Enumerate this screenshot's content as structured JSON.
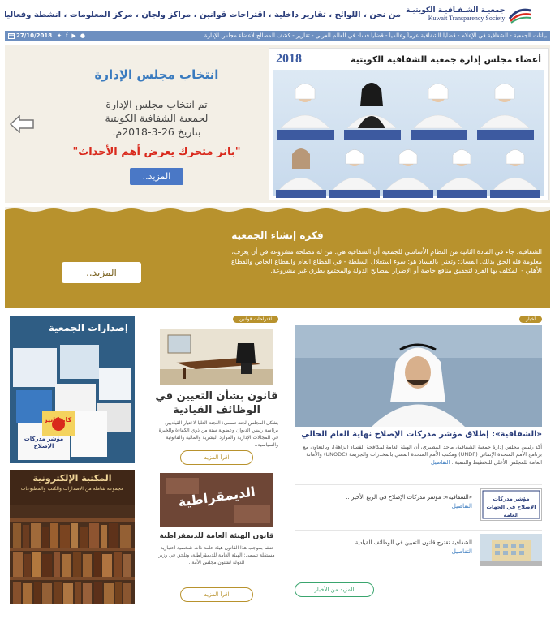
{
  "header": {
    "logo_ar": "جمعيـة الشـفـافيـة الكويتيـة",
    "logo_en": "Kuwait Transparency Society",
    "nav_text": "من نحن ، اللوائح ، تقارير داخلية ، اقتراحات قوانين ، مراكز ولجان ، مركز المعلومات ، أنشطة وفعاليات ، تواصل"
  },
  "subbar": {
    "date": "27/10/2018",
    "news": "بيانات الجمعية - الشفافية في الإعلام - قضايا الشفافية عربياً وعالمياً - قضايا فساد في العالم العربي - تقارير - كشف المصالح لأعضاء مجلس الإدارة"
  },
  "slider": {
    "title": "انتخاب مجلس الإدارة",
    "body_lines": [
      "تم انتخاب مجلس الإدارة",
      "لجمعية الشفافية الكويتية",
      "بتاريخ 26-3-2018م."
    ],
    "banner": "\"بانر متحرك يعرض أهم الأحداث\"",
    "button": "المزيد..",
    "board_title": "أعضاء مجلس إدارة جمعية الشفافية الكويتية",
    "board_year": "2018"
  },
  "idea": {
    "title": "فكرة إنشاء الجمعية",
    "text": "الشفافية: جاء في المادة الثانية من النظام الأساسي للجمعية أن الشفافية هي: من له مصلحة مشروعة في أن يعرف، معلومة فله الحق بذلك. الفساد: وتعني بالفساد هو: سوء استغلال السلطة - في القطاع العام والقطاع الخاص والقطاع الأهلي - المكلف بها الفرد لتحقيق منافع خاصة أو الإضرار بمصالح الدولة والمجتمع بطرق غير مشروعة.",
    "button": "المزيد.."
  },
  "news": {
    "tag": "أخبار",
    "headline": "«الشفافية»: إطلاق مؤشر مدركات الإصلاح نهاية العام الحالي",
    "excerpt": "أكد رئيس مجلس إدارة جمعية الشفافية، ماجد المطيري، أن الهيئة العامة لمكافحة الفساد (نزاهة)، وبالتعاون مع برنامج الأمم المتحدة الإنمائي (UNDP) ومكتب الأمم المتحدة المعني بالمخدرات والجريمة (UNODC) والأمانة العامة للمجلس الأعلى للتخطيط والتنمية..",
    "excerpt_more": "التفاصيل",
    "item1_thumb": "مؤشر مدركات الإصلاح في الجهات العامة",
    "item1_text": "«الشفافية»: مؤشر مدركات الإصلاح في الربع الأخير ..",
    "item1_more": "التفاصيل",
    "item2_text": "الشفافية تقترح قانون التعيين في الوظائف القيادية..",
    "item2_more": "التفاصيل",
    "more_button": "المزيد من الأخبار"
  },
  "proposals": {
    "tag": "اقتراحات قوانين",
    "title": "قانون بشأن التعيين في الوظائف القيادية",
    "text": "يشكل المجلس لجنة تسمى: اللجنة العليا لاختيار القياديين برئاسة رئيس الديوان وعضوية ستة من ذوي الكفاءة والخبرة في المجالات الإدارية والموارد البشرية والمالية والقانونية والسياسية..",
    "button": "اقرأ المزيد",
    "demo_image_text": "الديمقراطية",
    "demo_title": "قانون الهيئة العامة للديمقراطية",
    "demo_text": "تنشأ بموجب هذا القانون هيئة عامة ذات شخصية اعتبارية مستقلة تسمى: الهيئة العامة للديمقراطية، وتلحق في وزير الدولة لشئون مجلس الأمة..",
    "demo_button": "اقرأ المزيد"
  },
  "side": {
    "pub_title": "إصدارات الجمعية",
    "pub_book": "كاريكاتير",
    "pub_book2": "مؤشر مدركات الإصلاح",
    "lib_title": "المكتبة الإلكترونية",
    "lib_sub": "مجموعة شاملة من الإصدارات والكتب والمطبوعات"
  },
  "colors": {
    "brand_blue": "#2a3d7a",
    "subbar": "#6d8fc0",
    "gold": "#b8922d",
    "banner_red": "#d9291c",
    "button_blue": "#4a78c6",
    "green": "#3aa56e"
  },
  "icons": [
    "calendar-icon",
    "twitter-icon",
    "facebook-icon",
    "youtube-icon",
    "whatsapp-icon",
    "arrow-left-icon",
    "arrow-right-icon"
  ]
}
